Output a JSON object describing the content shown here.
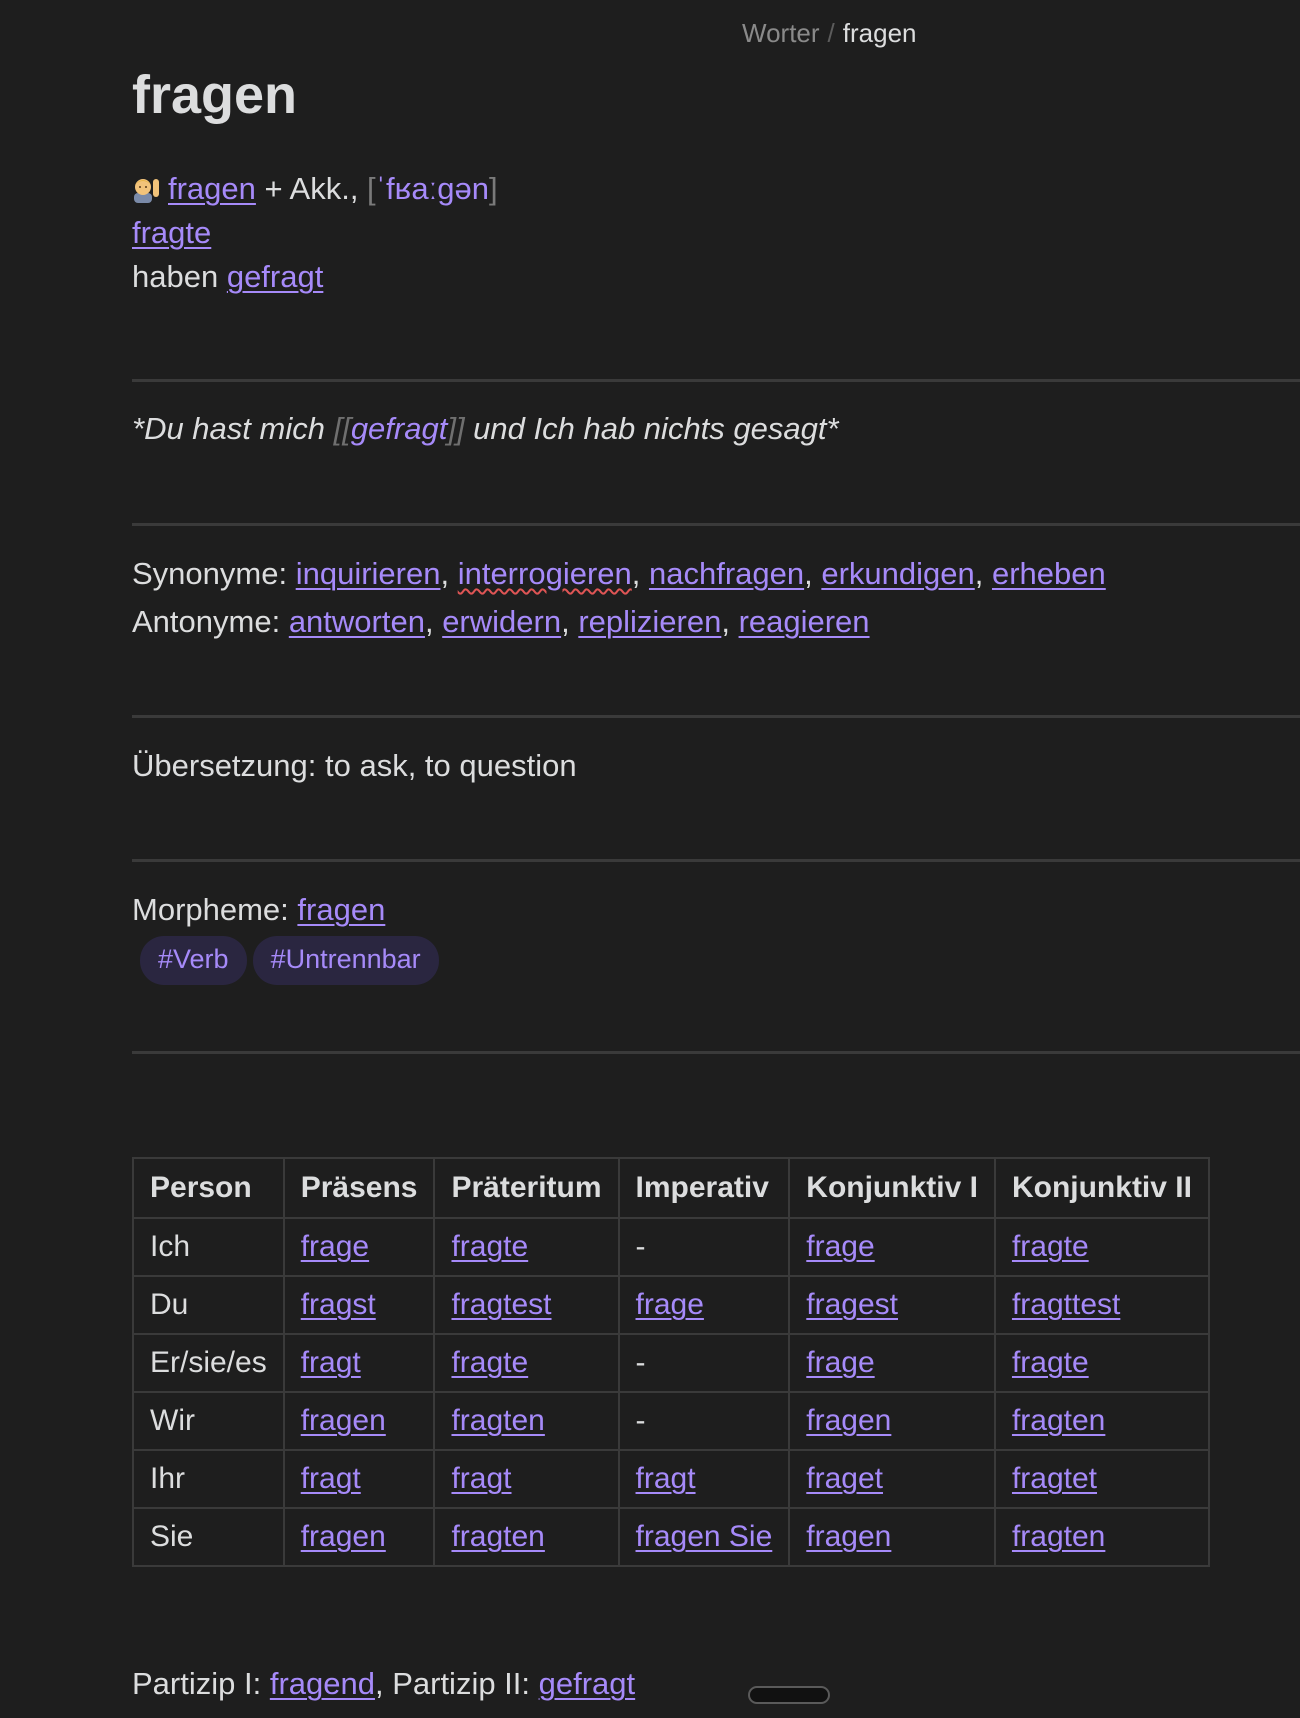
{
  "breadcrumb": {
    "parent": "Worter",
    "separator": "/",
    "current": "fragen"
  },
  "title": "fragen",
  "entry": {
    "emoji": "person-raising-hand-emoji",
    "infinitive": "fragen",
    "case": " + Akk., ",
    "ipa_open": "[",
    "ipa": "ˈfʁaːgən",
    "ipa_close": "]",
    "preterite": "fragte",
    "aux": "haben ",
    "participle": "gefragt"
  },
  "example": {
    "before": "*Du hast mich ",
    "open": "[[",
    "link": "gefragt",
    "close": "]]",
    "after": " und Ich hab nichts gesagt*"
  },
  "synonyms": {
    "label": "Synonyme: ",
    "items": [
      "inquirieren",
      "interrogieren",
      "nachfragen",
      "erkundigen",
      "erheben"
    ]
  },
  "antonyms": {
    "label": "Antonyme: ",
    "items": [
      "antworten",
      "erwidern",
      "replizieren",
      "reagieren"
    ]
  },
  "translation": "Übersetzung: to ask, to question",
  "morphemes": {
    "label": "Morpheme: ",
    "value": "fragen"
  },
  "tags": [
    "#Verb",
    "#Untrennbar"
  ],
  "conjugation": {
    "headers": [
      "Person",
      "Präsens",
      "Präteritum",
      "Imperativ",
      "Konjunktiv I",
      "Konjunktiv II"
    ],
    "rows": [
      [
        "Ich",
        "frage",
        "fragte",
        "-",
        "frage",
        "fragte"
      ],
      [
        "Du",
        "fragst",
        "fragtest",
        "frage",
        "fragest",
        "fragttest"
      ],
      [
        "Er/sie/es",
        "fragt",
        "fragte",
        "-",
        "frage",
        "fragte"
      ],
      [
        "Wir",
        "fragen",
        "fragten",
        "-",
        "fragen",
        "fragten"
      ],
      [
        "Ihr",
        "fragt",
        "fragt",
        "fragt",
        "fraget",
        "fragtet"
      ],
      [
        "Sie",
        "fragen",
        "fragten",
        "fragen Sie",
        "fragen",
        "fragten"
      ]
    ]
  },
  "participles": {
    "p1_label": "Partizip I: ",
    "p1": "fragend",
    "sep": ", ",
    "p2_label": "Partizip II: ",
    "p2": "gefragt"
  },
  "colors": {
    "background": "#1e1e1e",
    "text": "#dcddde",
    "link": "#a68af9",
    "rule": "#3a3a3a"
  }
}
